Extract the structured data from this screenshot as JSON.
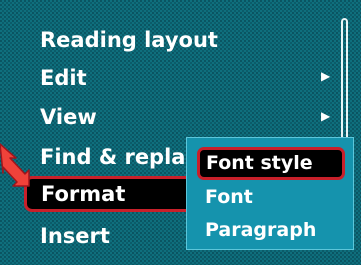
{
  "menu": {
    "items": [
      {
        "label": "Reading layout"
      },
      {
        "label": "Edit",
        "icon": "chevron-right-icon"
      },
      {
        "label": "View",
        "icon": "chevron-right-icon"
      },
      {
        "label": "Find & replace"
      },
      {
        "label": "Format",
        "selected": true
      },
      {
        "label": "Insert"
      }
    ]
  },
  "submenu": {
    "items": [
      {
        "label": "Font style",
        "selected": true
      },
      {
        "label": "Font"
      },
      {
        "label": "Paragraph"
      }
    ]
  },
  "colors": {
    "background": "#0f6f7d",
    "highlight_border": "#c8202a",
    "submenu_background": "#1593ad",
    "text": "#ffffff"
  }
}
